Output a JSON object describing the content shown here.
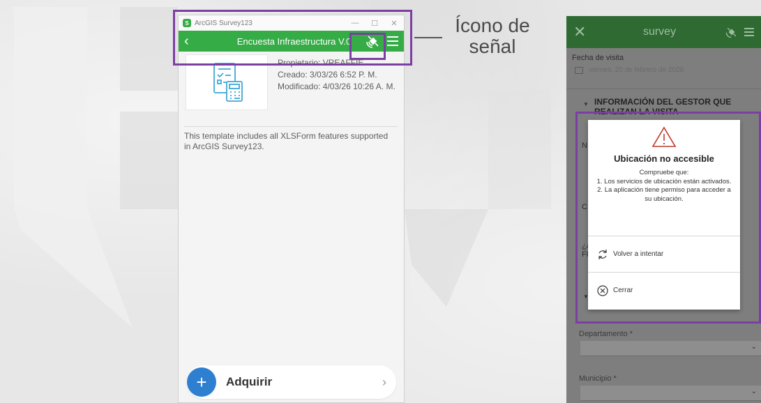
{
  "left_window": {
    "window_title": "ArcGIS Survey123",
    "min_label": "—",
    "max_label": "☐",
    "close_label": "✕",
    "back_label": "‹",
    "survey_title": "Encuesta Infraestructura V.0",
    "meta": {
      "owner": "Propietario: VREAFFIE",
      "created": "Creado: 3/03/26 6:52 P. M.",
      "modified": "Modificado: 4/03/26 10:26 A. M."
    },
    "description": "This template includes all XLSForm features supported in ArcGIS Survey123.",
    "acquire_label": "Adquirir",
    "acquire_plus": "+",
    "acquire_chevron": "›"
  },
  "callout": {
    "line1": "Ícono de",
    "line2": "señal"
  },
  "phone": {
    "close_label": "✕",
    "title": "survey",
    "visit_date_label": "Fecha de visita",
    "visit_date_value": "viernes, 20 de febrero de 2026",
    "section_title": "INFORMACIÓN DEL GESTOR QUE REALIZAN LA VISITA",
    "section_toggle": "▼",
    "section_toggle_lower": "▼",
    "partial_n": "N",
    "partial_c": "C",
    "partial_q": "¿A",
    "partial_f": "FF",
    "department_label": "Departamento *",
    "municipality_label": "Municipio *",
    "dropdown_caret": "⌄",
    "dialog": {
      "title": "Ubicación no accesible",
      "line1": "Compruebe que:",
      "line2": "1. Los servicios de ubicación están activados.",
      "line3": "2. La aplicación tiene permiso para acceder a su ubicación.",
      "retry_label": "Volver a intentar",
      "close_label": "Cerrar"
    }
  },
  "colors": {
    "app_green": "#35ac46",
    "dim_green": "#2f6a33",
    "accent_blue": "#2f7fd0",
    "highlight_purple": "#7b3ea3"
  }
}
